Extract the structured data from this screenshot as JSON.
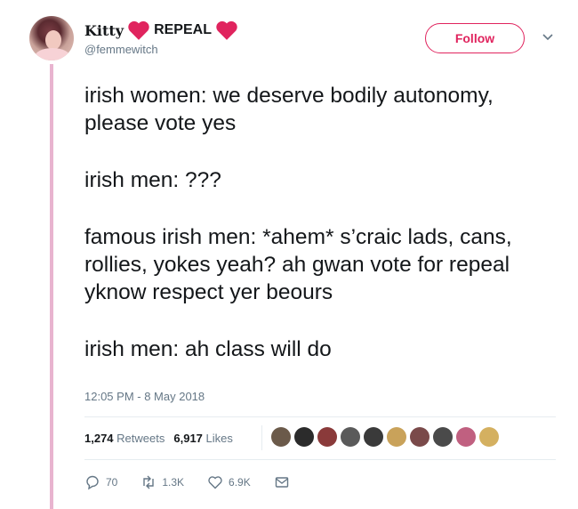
{
  "user": {
    "display_name": "Kitty",
    "name_suffix": "REPEAL",
    "handle": "@femmewitch"
  },
  "follow_button": {
    "label": "Follow"
  },
  "tweet": {
    "paragraphs": [
      "irish women: we deserve bodily autonomy, please vote yes",
      "irish men: ???",
      "famous irish men: *ahem* s’craic lads, cans, rollies, yokes yeah? ah gwan vote for repeal yknow respect yer beours",
      "irish men: ah class will do"
    ],
    "timestamp": "12:05 PM - 8 May 2018"
  },
  "stats": {
    "retweets_count": "1,274",
    "retweets_label": "Retweets",
    "likes_count": "6,917",
    "likes_label": "Likes"
  },
  "likers": {
    "colors": [
      "#6b5a4a",
      "#2b2b2b",
      "#8a3a3a",
      "#5a5a5a",
      "#3a3a3a",
      "#c9a25a",
      "#7a4a4a",
      "#4a4a4a",
      "#c06080",
      "#d4b060"
    ]
  },
  "actions": {
    "reply_count": "70",
    "retweet_count": "1.3K",
    "like_count": "6.9K"
  },
  "colors": {
    "accent": "#e0245e",
    "heart": "#e0245e",
    "muted": "#657786",
    "thread_line": "#e8b4cf"
  }
}
